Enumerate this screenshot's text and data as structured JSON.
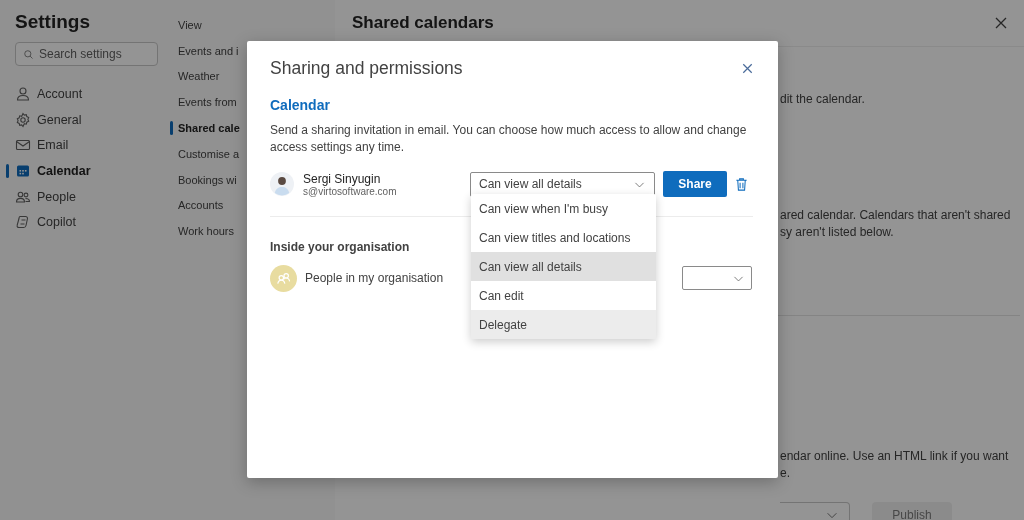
{
  "settings": {
    "title": "Settings",
    "search": {
      "placeholder": "Search settings"
    },
    "nav": [
      {
        "label": "Account",
        "selected": false
      },
      {
        "label": "General",
        "selected": false
      },
      {
        "label": "Email",
        "selected": false
      },
      {
        "label": "Calendar",
        "selected": true
      },
      {
        "label": "People",
        "selected": false
      },
      {
        "label": "Copilot",
        "selected": false
      }
    ]
  },
  "calendar_nav": [
    {
      "label": "View",
      "selected": false
    },
    {
      "label": "Events and i",
      "selected": false
    },
    {
      "label": "Weather",
      "selected": false
    },
    {
      "label": "Events from",
      "selected": false
    },
    {
      "label": "Shared cale",
      "selected": true
    },
    {
      "label": "Customise a",
      "selected": false
    },
    {
      "label": "Bookings wi",
      "selected": false
    },
    {
      "label": "Accounts",
      "selected": false
    },
    {
      "label": "Work hours",
      "selected": false
    }
  ],
  "panel": {
    "title": "Shared calendars",
    "texts": [
      {
        "lines": [
          "dit the calendar."
        ]
      },
      {
        "lines": [
          "ared calendar. Calendars that aren't shared",
          "sy aren't listed below."
        ]
      },
      {
        "lines": [
          "endar online. Use an HTML link if you want",
          "e."
        ]
      }
    ],
    "publish_button": {
      "label": "Publish",
      "disabled": true
    }
  },
  "dialog": {
    "title": "Sharing and permissions",
    "section": "Calendar",
    "description": "Send a sharing invitation in email. You can choose how much access to allow and change access settings any time.",
    "invitee": {
      "name": "Sergi Sinyugin",
      "email": "s@virtosoftware.com",
      "permission": "Can view all details"
    },
    "share_button": "Share",
    "org": {
      "heading": "Inside your organisation",
      "name": "People in my organisation"
    },
    "permission_menu": [
      {
        "label": "Can view when I'm busy",
        "selected": false,
        "hovered": false
      },
      {
        "label": "Can view titles and locations",
        "selected": false,
        "hovered": false
      },
      {
        "label": "Can view all details",
        "selected": true,
        "hovered": false
      },
      {
        "label": "Can edit",
        "selected": false,
        "hovered": false
      },
      {
        "label": "Delegate",
        "selected": false,
        "hovered": true
      }
    ]
  }
}
